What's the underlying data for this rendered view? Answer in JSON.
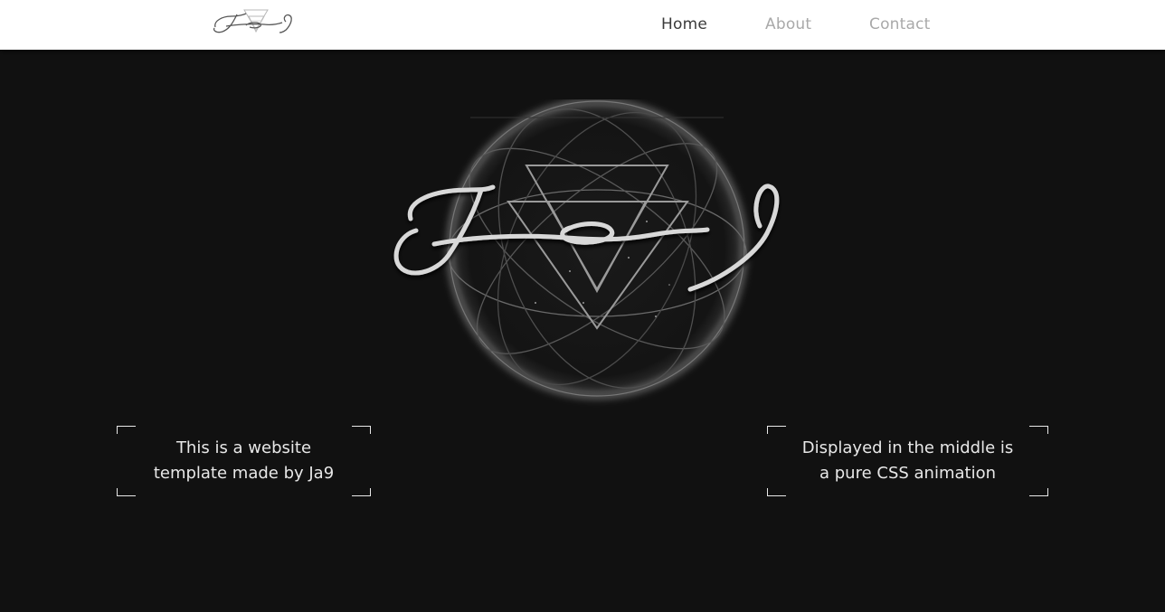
{
  "brand": {
    "logo_icon": "ja9-logo-icon",
    "logo_text": "Ja9"
  },
  "nav": {
    "items": [
      {
        "label": "Home",
        "active": true
      },
      {
        "label": "About",
        "active": false
      },
      {
        "label": "Contact",
        "active": false
      }
    ]
  },
  "hero": {
    "animation_icon": "ja9-orbit-animation"
  },
  "info_left": {
    "line1": "This is a website",
    "line2": "template made by Ja9"
  },
  "info_right": {
    "line1": "Displayed in the middle is",
    "line2": "a pure CSS animation"
  },
  "colors": {
    "background": "#111111",
    "navbar": "#ffffff",
    "nav_active": "#3a3a3a",
    "nav_inactive": "#a9a9a9",
    "text": "#e8e8e8"
  }
}
